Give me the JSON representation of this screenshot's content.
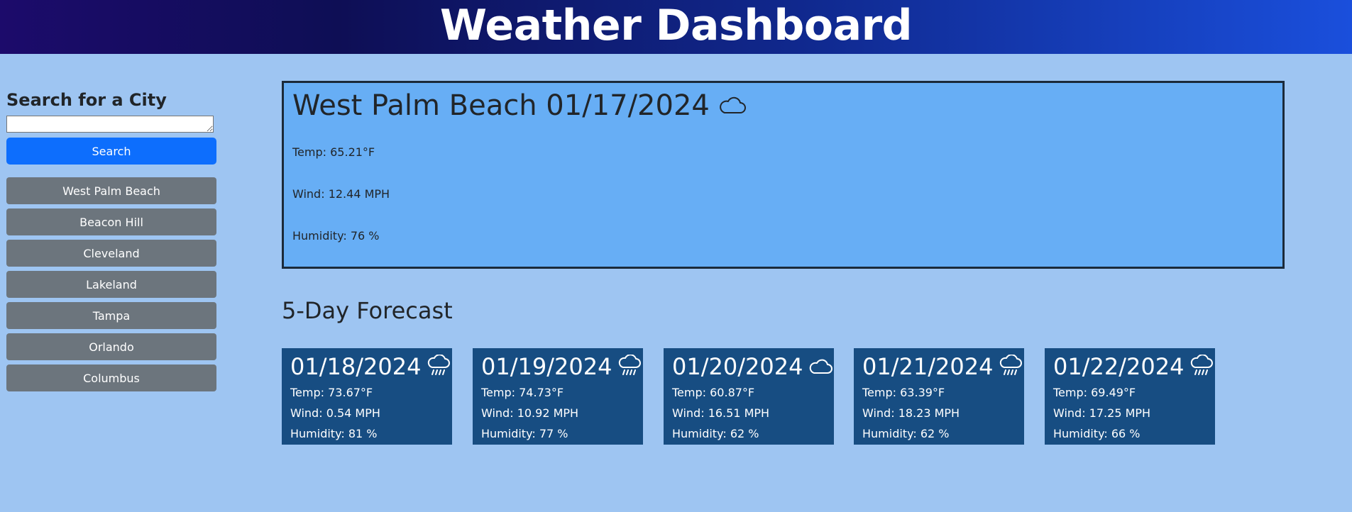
{
  "header": {
    "title": "Weather Dashboard"
  },
  "search": {
    "heading": "Search for a City",
    "input_value": "",
    "button_label": "Search"
  },
  "history": [
    "West Palm Beach",
    "Beacon Hill",
    "Cleveland",
    "Lakeland",
    "Tampa",
    "Orlando",
    "Columbus"
  ],
  "current": {
    "title": "West Palm Beach 01/17/2024",
    "icon": "cloud-icon",
    "temp": "Temp: 65.21°F",
    "wind": "Wind: 12.44 MPH",
    "humidity": "Humidity: 76 %"
  },
  "forecast": {
    "heading": "5-Day Forecast",
    "days": [
      {
        "date": "01/18/2024",
        "icon": "rain-icon",
        "temp": "Temp: 73.67°F",
        "wind": "Wind: 0.54 MPH",
        "humidity": "Humidity: 81 %"
      },
      {
        "date": "01/19/2024",
        "icon": "rain-icon",
        "temp": "Temp: 74.73°F",
        "wind": "Wind: 10.92 MPH",
        "humidity": "Humidity: 77 %"
      },
      {
        "date": "01/20/2024",
        "icon": "cloud-icon",
        "temp": "Temp: 60.87°F",
        "wind": "Wind: 16.51 MPH",
        "humidity": "Humidity: 62 %"
      },
      {
        "date": "01/21/2024",
        "icon": "rain-icon",
        "temp": "Temp: 63.39°F",
        "wind": "Wind: 18.23 MPH",
        "humidity": "Humidity: 62 %"
      },
      {
        "date": "01/22/2024",
        "icon": "rain-icon",
        "temp": "Temp: 69.49°F",
        "wind": "Wind: 17.25 MPH",
        "humidity": "Humidity: 66 %"
      }
    ]
  },
  "colors": {
    "page_bg": "#9ec5f2",
    "current_bg": "#67aef5",
    "card_bg": "#174d82",
    "primary": "#0d6efd",
    "secondary": "#6c757d"
  }
}
